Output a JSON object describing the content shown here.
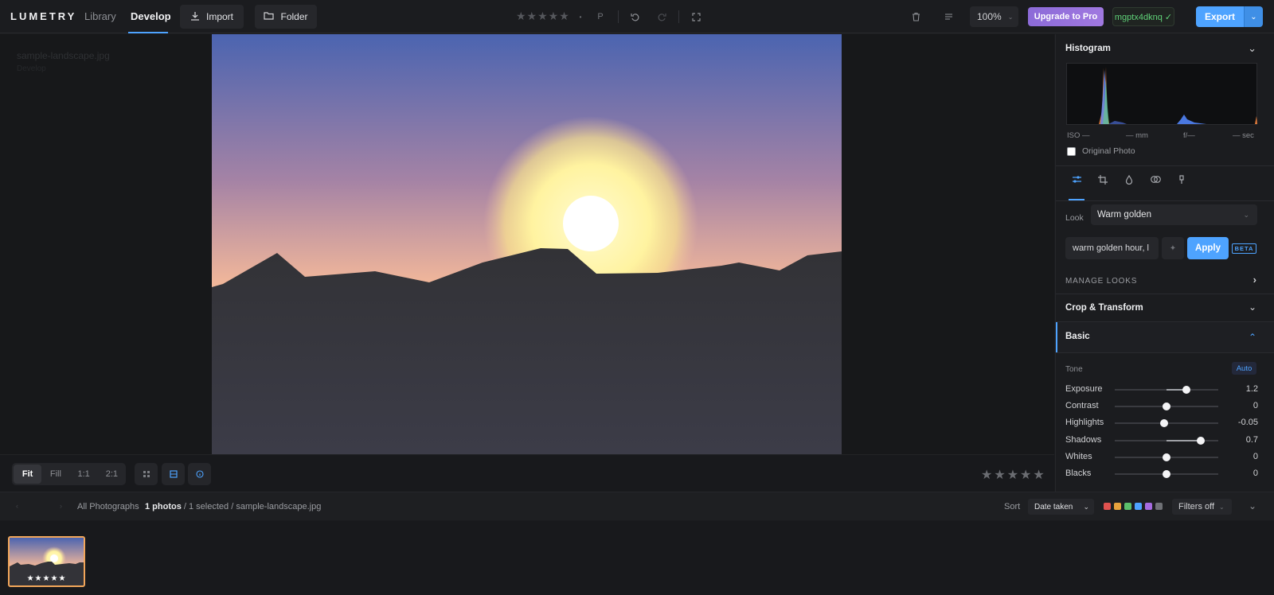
{
  "app": {
    "logo": "LUMETRY",
    "tabs": [
      {
        "label": "Library"
      },
      {
        "label": "Develop"
      }
    ],
    "import_label": "Import",
    "folder_label": "Folder",
    "rating_stars": "★★★★★",
    "rating_dot": "•",
    "flag_label": "P",
    "zoom": "100%",
    "upgrade_label": "Upgrade to Pro",
    "user_badge": "mgptx4dknq ✓",
    "export_label": "Export"
  },
  "viewer": {
    "filename": "sample-landscape.jpg",
    "file_sub": "Develop",
    "view_modes": [
      "Fit",
      "Fill",
      "1:1",
      "2:1"
    ],
    "active_view_mode": "Fit",
    "rating_stars": "★★★★★",
    "rating": 0
  },
  "panel": {
    "histogram_title": "Histogram",
    "exif": {
      "iso": "ISO —",
      "focal": "— mm",
      "aperture": "f/—",
      "shutter": "— sec"
    },
    "original_photo_label": "Original Photo",
    "look_label": "Look",
    "look_value": "Warm golden",
    "prompt_value": "warm golden hour, l",
    "apply_label": "Apply",
    "beta_label": "BETA",
    "manage_looks": "MANAGE LOOKS",
    "crop_title": "Crop & Transform",
    "basic_title": "Basic",
    "tone_label": "Tone",
    "auto_label": "Auto",
    "sliders": [
      {
        "label": "Exposure",
        "value": "1.2",
        "pos": 0.69
      },
      {
        "label": "Contrast",
        "value": "0",
        "pos": 0.5
      },
      {
        "label": "Highlights",
        "value": "-0.05",
        "pos": 0.475
      },
      {
        "label": "Shadows",
        "value": "0.7",
        "pos": 0.83
      },
      {
        "label": "Whites",
        "value": "0",
        "pos": 0.5
      },
      {
        "label": "Blacks",
        "value": "0",
        "pos": 0.5
      }
    ]
  },
  "filmbar": {
    "breadcrumb": "All Photographs",
    "count": "1 photos",
    "selection": " / 1 selected / sample-landscape.jpg",
    "sort_label": "Sort",
    "sort_value": "Date taken",
    "filters_label": "Filters off",
    "color_labels": [
      "#e0524f",
      "#e8a33d",
      "#5bbf6a",
      "#4ea3ff",
      "#a66be0",
      "#6f7176"
    ]
  },
  "filmstrip": {
    "thumb_stars": "★★★★★"
  },
  "colors": {
    "accent": "#4ea3ff",
    "upgrade": "#9a74de",
    "selected_thumb": "#f2a65a"
  }
}
